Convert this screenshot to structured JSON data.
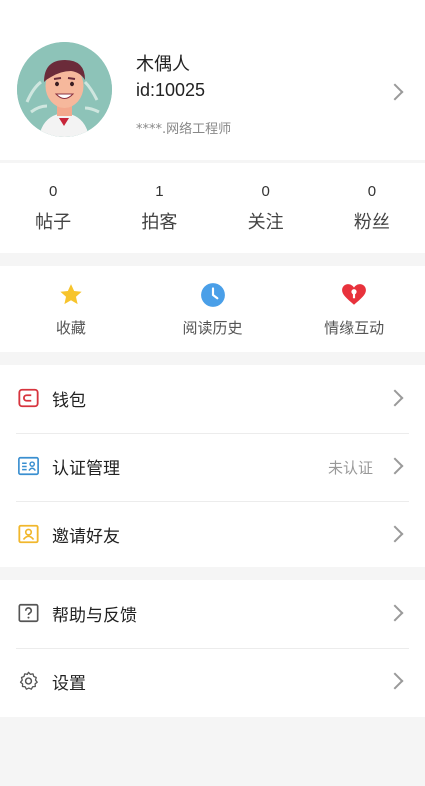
{
  "profile": {
    "name": "木偶人",
    "id": "id:10025",
    "title": "****.网络工程师"
  },
  "stats": [
    {
      "value": "0",
      "label": "帖子"
    },
    {
      "value": "1",
      "label": "拍客"
    },
    {
      "value": "0",
      "label": "关注"
    },
    {
      "value": "0",
      "label": "粉丝"
    }
  ],
  "quick_actions": [
    {
      "label": "收藏",
      "icon": "star-icon",
      "color": "#f7c42c"
    },
    {
      "label": "阅读历史",
      "icon": "clock-icon",
      "color": "#4a9fe8"
    },
    {
      "label": "情缘互动",
      "icon": "heart-lock-icon",
      "color": "#e8323c"
    }
  ],
  "menu": [
    {
      "label": "钱包",
      "value": "",
      "icon": "wallet-icon",
      "color": "#d7343e"
    },
    {
      "label": "认证管理",
      "value": "未认证",
      "icon": "id-card-icon",
      "color": "#3a8fd0"
    },
    {
      "label": "邀请好友",
      "value": "",
      "icon": "invite-icon",
      "color": "#f1b72c"
    },
    {
      "label": "帮助与反馈",
      "value": "",
      "icon": "help-icon",
      "color": "#555555"
    },
    {
      "label": "设置",
      "value": "",
      "icon": "gear-icon",
      "color": "#555555"
    }
  ]
}
